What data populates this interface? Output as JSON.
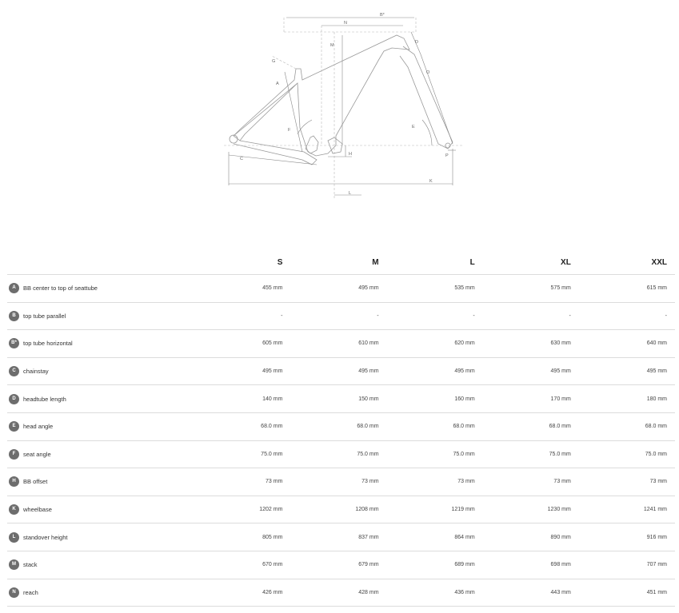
{
  "diagram": {
    "labels": {
      "a": "A",
      "b_star": "B*",
      "c": "C",
      "d": "D",
      "e": "E",
      "f": "F",
      "g": "G",
      "h": "H",
      "k": "K",
      "l": "L",
      "m": "M",
      "n": "N",
      "o": "O",
      "p": "P"
    }
  },
  "table": {
    "sizes": [
      "S",
      "M",
      "L",
      "XL",
      "XXL"
    ],
    "rows": [
      {
        "key": "A",
        "name": "BB center to top of seattube",
        "values": [
          "455 mm",
          "495 mm",
          "535 mm",
          "575 mm",
          "615 mm"
        ]
      },
      {
        "key": "B",
        "name": "top tube parallel",
        "values": [
          "-",
          "-",
          "-",
          "-",
          "-"
        ]
      },
      {
        "key": "B*",
        "name": "top tube horizontal",
        "values": [
          "605 mm",
          "610 mm",
          "620 mm",
          "630 mm",
          "640 mm"
        ]
      },
      {
        "key": "C",
        "name": "chainstay",
        "values": [
          "495 mm",
          "495 mm",
          "495 mm",
          "495 mm",
          "495 mm"
        ]
      },
      {
        "key": "D",
        "name": "headtube length",
        "values": [
          "140 mm",
          "150 mm",
          "160 mm",
          "170 mm",
          "180 mm"
        ]
      },
      {
        "key": "E",
        "name": "head angle",
        "values": [
          "68.0 mm",
          "68.0 mm",
          "68.0 mm",
          "68.0 mm",
          "68.0 mm"
        ]
      },
      {
        "key": "F",
        "name": "seat angle",
        "values": [
          "75.0 mm",
          "75.0 mm",
          "75.0 mm",
          "75.0 mm",
          "75.0 mm"
        ]
      },
      {
        "key": "H",
        "name": "BB offset",
        "values": [
          "73 mm",
          "73 mm",
          "73 mm",
          "73 mm",
          "73 mm"
        ]
      },
      {
        "key": "K",
        "name": "wheelbase",
        "values": [
          "1202 mm",
          "1208 mm",
          "1219 mm",
          "1230 mm",
          "1241 mm"
        ]
      },
      {
        "key": "L",
        "name": "standover height",
        "values": [
          "805 mm",
          "837 mm",
          "864 mm",
          "890 mm",
          "916 mm"
        ]
      },
      {
        "key": "M",
        "name": "stack",
        "values": [
          "670 mm",
          "679 mm",
          "689 mm",
          "698 mm",
          "707 mm"
        ]
      },
      {
        "key": "N",
        "name": "reach",
        "values": [
          "426 mm",
          "428 mm",
          "436 mm",
          "443 mm",
          "451 mm"
        ]
      }
    ]
  }
}
